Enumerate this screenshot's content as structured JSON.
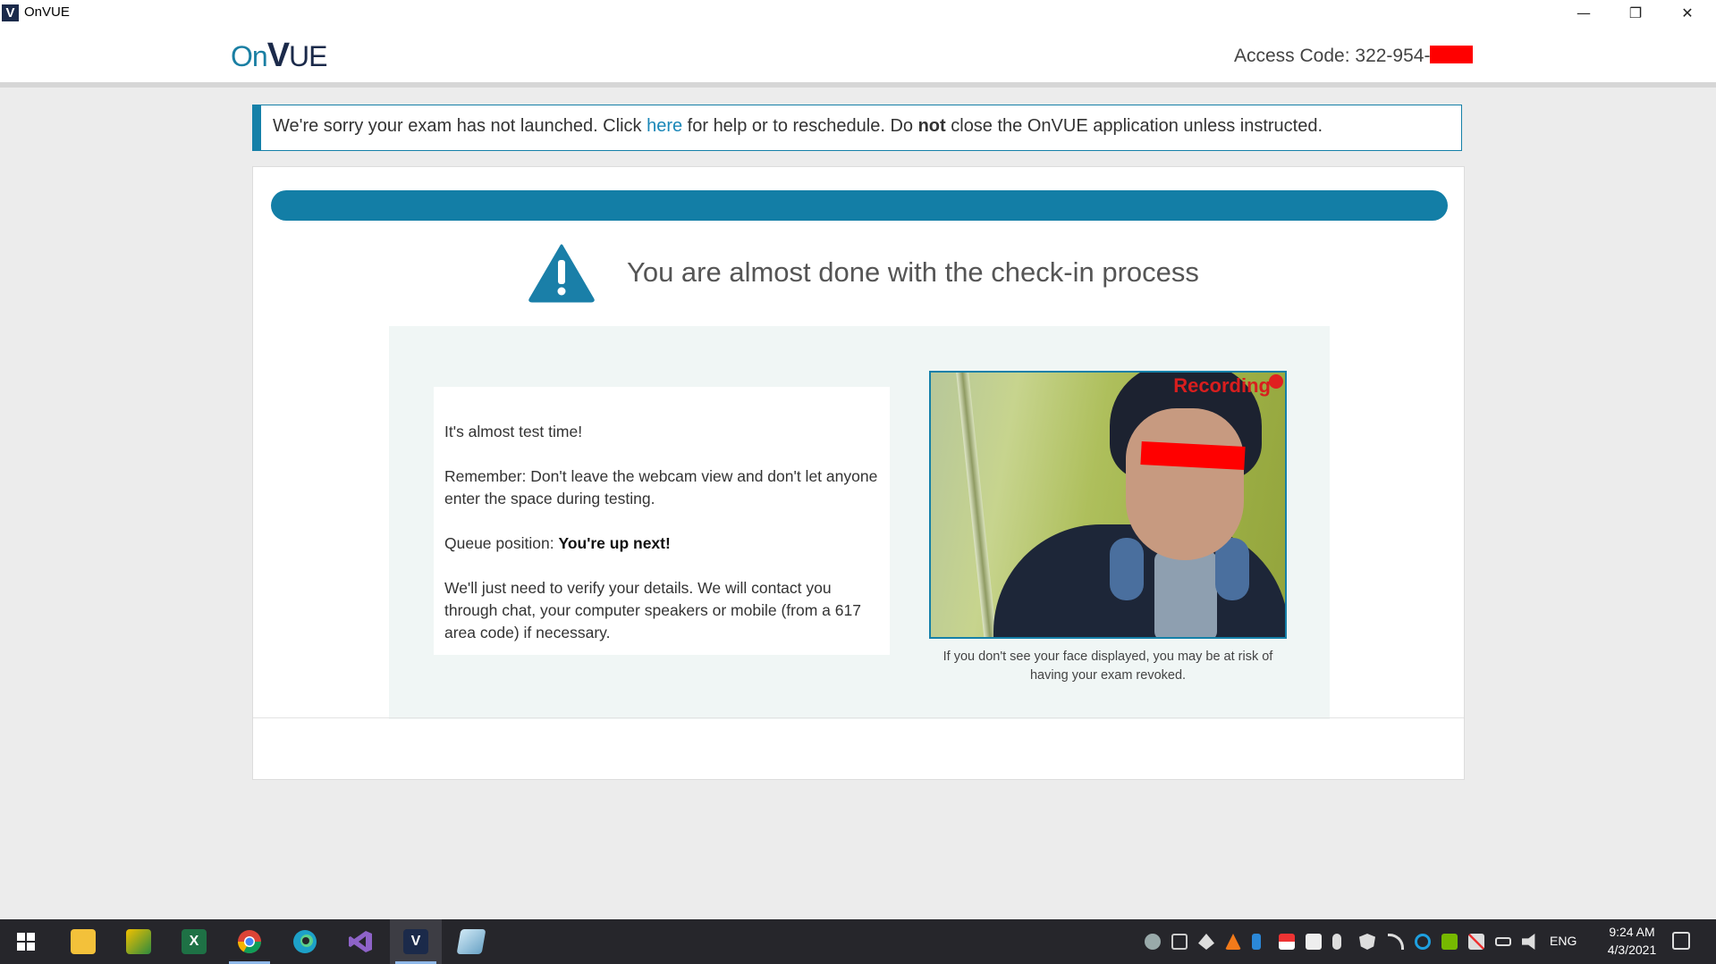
{
  "window": {
    "title": "OnVUE",
    "app_icon_letter": "V",
    "minimize": "—",
    "restore": "❐",
    "close": "✕"
  },
  "header": {
    "logo_on": "On",
    "logo_v": "V",
    "logo_ue": "UE",
    "access_code_label": "Access Code: 322-954-"
  },
  "alert": {
    "text_before": "We're sorry your exam has not launched. Click ",
    "link": "here",
    "text_middle": " for help or to reschedule. Do ",
    "bold": "not",
    "text_after": " close the OnVUE application unless instructed."
  },
  "main": {
    "headline": "You are almost done with the check-in process",
    "intro": "It's almost test time!",
    "reminder": "Remember: Don't leave the webcam view and don't let anyone enter the space during testing.",
    "queue_label": "Queue position: ",
    "queue_value": "You're up next!",
    "verify": "We'll just need to verify your details. We will contact you through chat, your computer speakers or mobile (from a 617 area code) if necessary.",
    "recording_label": "Recording",
    "webcam_caption": "If you don't see your face displayed, you may be at risk of having your exam revoked."
  },
  "taskbar": {
    "apps": [
      {
        "name": "start",
        "icon": "windows-icon"
      },
      {
        "name": "file-explorer",
        "icon": "folder-icon"
      },
      {
        "name": "app-2",
        "icon": "app-icon"
      },
      {
        "name": "excel",
        "icon": "excel-icon",
        "letter": "X"
      },
      {
        "name": "chrome",
        "icon": "chrome-icon"
      },
      {
        "name": "edge",
        "icon": "edge-icon"
      },
      {
        "name": "visual-studio",
        "icon": "visual-studio-icon"
      },
      {
        "name": "onvue",
        "icon": "onvue-icon",
        "letter": "V"
      },
      {
        "name": "app-9",
        "icon": "app-icon"
      }
    ],
    "language": "ENG",
    "time": "9:24 AM",
    "date": "4/3/2021"
  },
  "colors": {
    "accent": "#137ea6",
    "link": "#1a87b8",
    "recording": "#d81e1e",
    "redaction": "#ff0000"
  }
}
